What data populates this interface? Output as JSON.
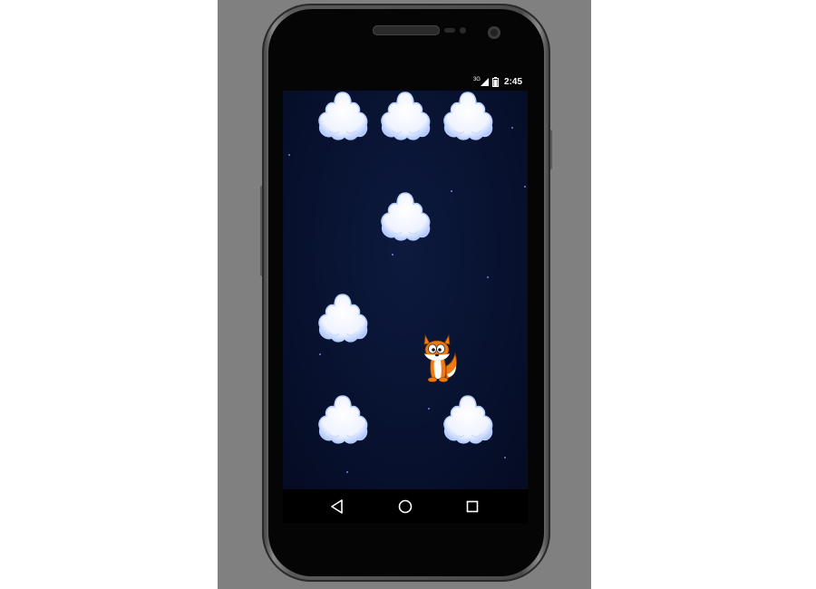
{
  "status_bar": {
    "network": "3G",
    "time": "2:45"
  },
  "game": {
    "character": "fox",
    "platform": "cloud",
    "background": "starry-night",
    "clouds_visible": 7
  },
  "navigation": {
    "buttons": [
      "back",
      "home",
      "recents"
    ]
  },
  "colors": {
    "emulator_frame": "#808080",
    "game_background": "#081230",
    "cloud_fill": "#eef3ff",
    "cloud_edge": "#a8c2ff",
    "fox_orange": "#f07a10"
  }
}
